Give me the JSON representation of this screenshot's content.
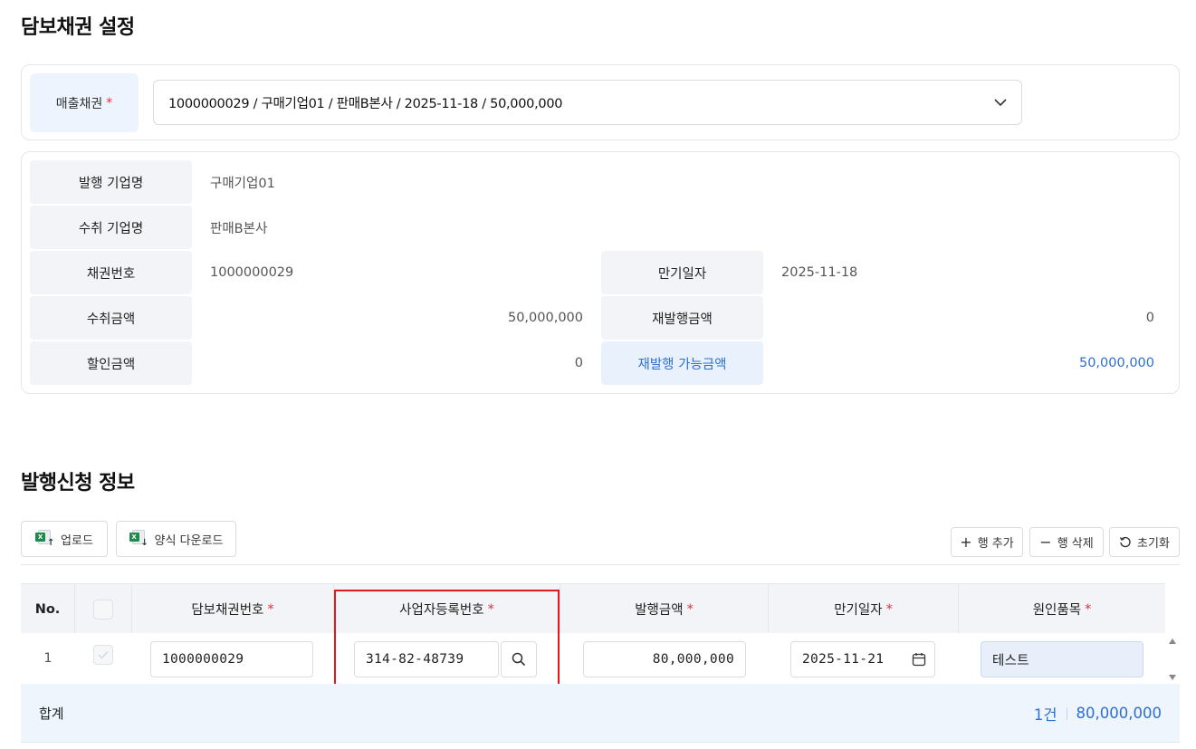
{
  "sections": {
    "collateral_title": "담보채권 설정",
    "issue_title": "발행신청 정보"
  },
  "receivable": {
    "label": "매출채권",
    "required_mark": "*",
    "selected": "1000000029 / 구매기업01 / 판매B본사 / 2025-11-18 / 50,000,000"
  },
  "info": {
    "issuer_label": "발행 기업명",
    "issuer_value": "구매기업01",
    "receiver_label": "수취 기업명",
    "receiver_value": "판매B본사",
    "bond_no_label": "채권번호",
    "bond_no_value": "1000000029",
    "due_label": "만기일자",
    "due_value": "2025-11-18",
    "recv_amt_label": "수취금액",
    "recv_amt_value": "50,000,000",
    "reissue_amt_label": "재발행금액",
    "reissue_amt_value": "0",
    "discount_label": "할인금액",
    "discount_value": "0",
    "reissue_avail_label": "재발행 가능금액",
    "reissue_avail_value": "50,000,000"
  },
  "toolbar": {
    "upload": "업로드",
    "template_download": "양식 다운로드",
    "add_row": "행 추가",
    "delete_row": "행 삭제",
    "reset": "초기화"
  },
  "table": {
    "headers": {
      "no": "No.",
      "bond_no": "담보채권번호",
      "biz_no": "사업자등록번호",
      "amount": "발행금액",
      "due": "만기일자",
      "item": "원인품목",
      "req": "*"
    },
    "rows": [
      {
        "no": "1",
        "bond_no": "1000000029",
        "biz_no": "314-82-48739",
        "amount": "80,000,000",
        "due": "2025-11-21",
        "item": "테스트"
      }
    ]
  },
  "total": {
    "label": "합계",
    "count": "1건",
    "amount": "80,000,000"
  },
  "colors": {
    "accent": "#2f6fd0",
    "required": "#e0303a",
    "highlight": "#e0191e"
  }
}
